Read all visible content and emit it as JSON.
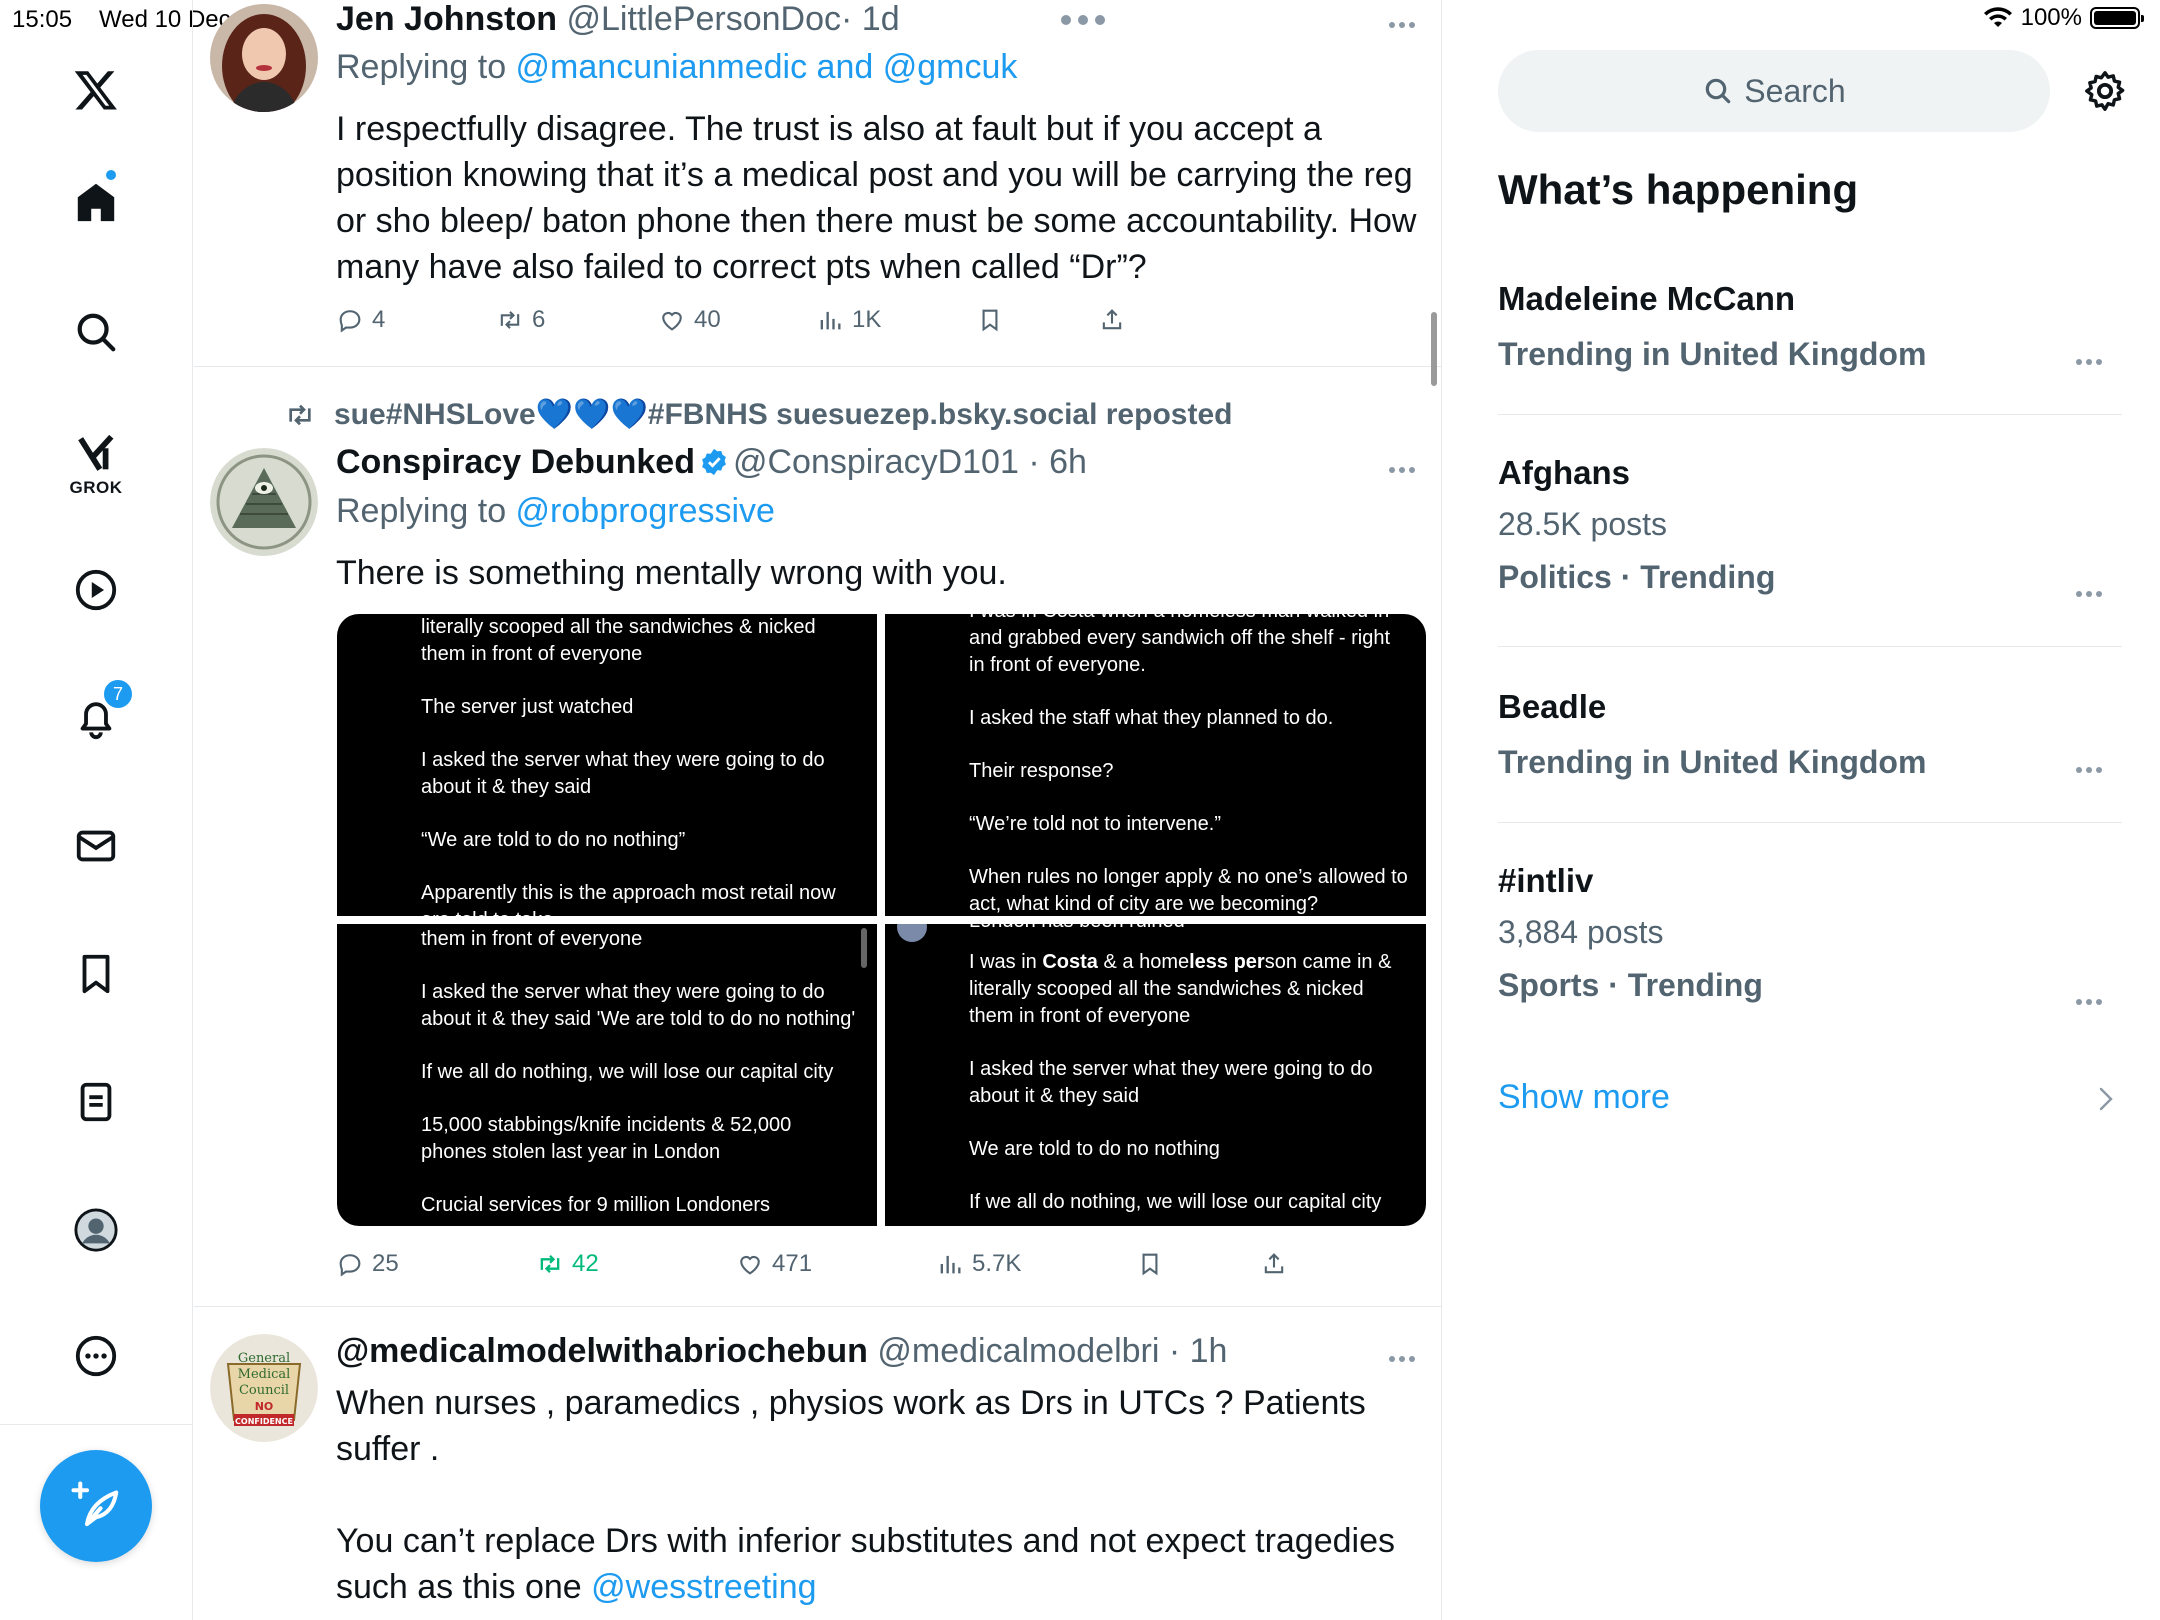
{
  "status": {
    "time": "15:05",
    "date": "Wed 10 Dec",
    "battery": "100%"
  },
  "nav": {
    "items": [
      {
        "name": "x-logo",
        "icon": "x-logo-icon"
      },
      {
        "name": "home",
        "icon": "home-icon",
        "has_dot": true
      },
      {
        "name": "explore",
        "icon": "search-icon"
      },
      {
        "name": "grok",
        "icon": "grok-icon",
        "label": "GROK"
      },
      {
        "name": "videos",
        "icon": "play-icon"
      },
      {
        "name": "notifications",
        "icon": "bell-icon",
        "badge": "7"
      },
      {
        "name": "messages",
        "icon": "mail-icon"
      },
      {
        "name": "bookmarks",
        "icon": "bookmark-icon"
      },
      {
        "name": "lists",
        "icon": "list-icon"
      },
      {
        "name": "profile",
        "icon": "avatar-icon"
      },
      {
        "name": "more",
        "icon": "more-circle-icon"
      }
    ],
    "compose_icon": "compose-icon"
  },
  "tweets": [
    {
      "name": "Jen Johnston",
      "handle": "@LittlePersonDoc",
      "time": "· 1d",
      "replying_prefix": "Replying to ",
      "replying_to": "@mancunianmedic and @gmcuk",
      "text": "I respectfully disagree. The trust is also at fault but if you accept a position knowing that it’s a medical post and you will be carrying the reg or sho bleep/ baton phone then there must be some accountability. How many have also failed to correct pts when called “Dr”?",
      "stats": {
        "replies": "4",
        "reposts": "6",
        "likes": "40",
        "views": "1K"
      }
    },
    {
      "repost_by": "sue#NHSLove💙💙💙#FBNHS suesuezep.bsky.social reposted",
      "name": "Conspiracy Debunked",
      "verified": true,
      "handle": "@ConspiracyD101",
      "time": "· 6h",
      "replying_prefix": "Replying to ",
      "replying_to": "@robprogressive",
      "text": "There is something mentally wrong with you.",
      "media": {
        "tile1": [
          "literally scooped all the sandwiches & nicked them in front of everyone",
          "The server just watched",
          "I asked the server what they were going to do about it & they said",
          "“We are told to do no nothing”",
          "Apparently this is the approach most retail now are told to take"
        ],
        "tile2": [
          "I was in Costa when a homeless man walked in",
          "and grabbed every sandwich off the shelf - right in front of everyone.",
          "I asked the staff what they planned to do.",
          "Their response?",
          "“We’re told not to intervene.”",
          "When rules no longer apply & no one’s allowed to act, what kind of city are we becoming?"
        ],
        "tile3": [
          "them in front of everyone",
          "I asked the server what they were going to do about it & they said 'We are told to do no nothing'",
          "If we all do nothing, we will lose our capital city",
          "15,000 stabbings/knife incidents & 52,000 phones stolen last year in London",
          "Crucial services for 9 million Londoners"
        ],
        "tile4": {
          "top": "London has been ruined",
          "lines": [
            "I asked the server what they were going to do about it & they said",
            "We are told to do no nothing",
            "If we all do nothing, we will lose our capital city"
          ],
          "costa": {
            "p1": "I was in ",
            "b1": "Costa",
            "p2": " & a home",
            "b2": "less per",
            "p3": "son came in & literally scooped all the sandwiches & nicked them in front of everyone"
          }
        }
      },
      "stats": {
        "replies": "25",
        "reposts": "42",
        "likes": "471",
        "views": "5.7K"
      }
    },
    {
      "name": "@medicalmodelwithabriochebun",
      "handle": "@medicalmodelbri",
      "time": "· 1h",
      "text": "When nurses , paramedics , physios work as Drs in UTCs ? Patients suffer .",
      "text2": "You can’t replace Drs with inferior substitutes and not expect tragedies such as this one ",
      "mention": "@wesstreeting",
      "avatar_lines": [
        "General",
        "Medical",
        "Council",
        "NO",
        "CONFIDENCE"
      ]
    }
  ],
  "right": {
    "search_placeholder": "Search",
    "heading": "What’s happening",
    "trends": [
      {
        "title": "Madeleine McCann",
        "meta": "Trending in United Kingdom"
      },
      {
        "title": "Afghans",
        "posts": "28.5K posts",
        "meta": "Politics · Trending"
      },
      {
        "title": "Beadle",
        "meta": "Trending in United Kingdom"
      },
      {
        "title": "#intliv",
        "posts": "3,884 posts",
        "meta": "Sports · Trending"
      }
    ],
    "show_more": "Show more"
  },
  "colors": {
    "accent": "#1d9bf0",
    "repost_green": "#00ba7c",
    "muted": "#536471"
  }
}
